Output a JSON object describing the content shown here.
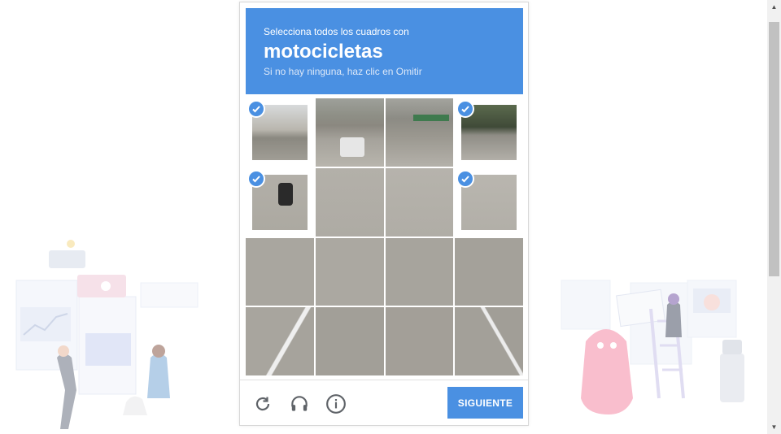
{
  "captcha": {
    "instruction": "Selecciona todos los cuadros con",
    "keyword": "motocicletas",
    "hint": "Si no hay ninguna, haz clic en Omitir",
    "next_label": "SIGUIENTE",
    "selected_tiles": [
      0,
      3,
      4,
      7
    ],
    "accent_color": "#4a90e2"
  },
  "icons": [
    "reload-icon",
    "audio-challenge-icon",
    "info-icon",
    "checkmark-icon"
  ]
}
